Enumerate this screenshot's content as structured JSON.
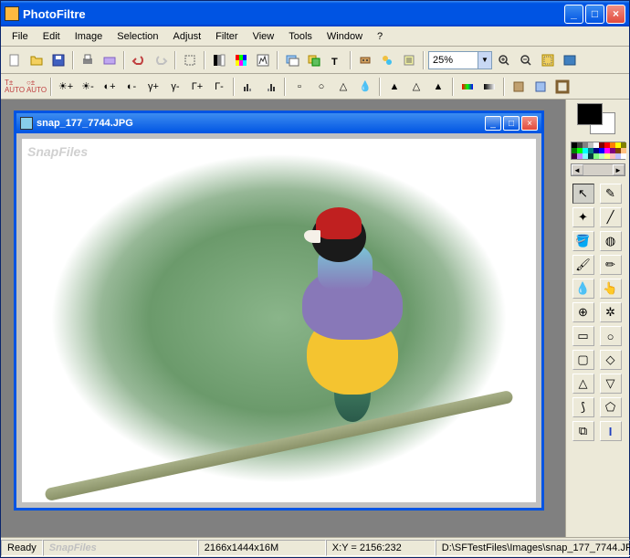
{
  "app": {
    "title": "PhotoFiltre"
  },
  "menu": [
    "File",
    "Edit",
    "Image",
    "Selection",
    "Adjust",
    "Filter",
    "View",
    "Tools",
    "Window",
    "?"
  ],
  "toolbar1_icons": [
    "new-icon",
    "open-icon",
    "save-icon",
    "print-icon",
    "scanner-icon",
    "undo-icon",
    "redo-icon",
    "selection-rect-icon",
    "grayscale-icon",
    "palette-icon",
    "levels-icon",
    "image-manager-icon",
    "layers-icon",
    "text-icon",
    "plugin-icon",
    "effects-icon",
    "options-icon"
  ],
  "zoom": {
    "value": "25%"
  },
  "toolbar1_zoom_icons": [
    "zoom-in-icon",
    "zoom-out-icon",
    "fit-window-icon",
    "fullscreen-icon"
  ],
  "toolbar2_icons": [
    "auto-levels-icon",
    "auto-contrast-icon",
    "bright-plus-icon",
    "bright-minus-icon",
    "contrast-plus-icon",
    "contrast-minus-icon",
    "gamma-plus-icon",
    "gamma-minus-icon",
    "sat-plus-icon",
    "sat-minus-icon",
    "hist-left-icon",
    "hist-right-icon",
    "sharpen-icon",
    "blur-icon",
    "sharpen-more-icon",
    "soften-icon",
    "hue-icon",
    "dust-icon",
    "relief-icon",
    "add-noise-icon",
    "gradient-icon",
    "grayscale2-icon",
    "sepia-icon",
    "photo-mask-icon",
    "frame-icon"
  ],
  "document": {
    "filename": "snap_177_7744.JPG",
    "watermark": "SnapFiles"
  },
  "colors": {
    "fg": "#000000",
    "bg": "#ffffff"
  },
  "palette": [
    "#000000",
    "#404040",
    "#808080",
    "#c0c0c0",
    "#ffffff",
    "#800000",
    "#ff0000",
    "#ff8000",
    "#ffff00",
    "#808000",
    "#008000",
    "#00ff00",
    "#00ffff",
    "#008080",
    "#000080",
    "#0000ff",
    "#ff00ff",
    "#800080",
    "#804000",
    "#ffc080",
    "#400040",
    "#c080ff",
    "#80ffff",
    "#004040",
    "#80ff80",
    "#c0ffc0",
    "#ffff80",
    "#ffc0c0",
    "#c0c0ff",
    "#ffffff"
  ],
  "tools": [
    "pointer-icon",
    "eyedropper-icon",
    "magic-wand-icon",
    "line-icon",
    "fill-icon",
    "spray-icon",
    "brush-icon",
    "adv-brush-icon",
    "blur-tool-icon",
    "smudge-icon",
    "clone-icon",
    "sharp-tool-icon",
    "rect-shape-icon",
    "ellipse-shape-icon",
    "rounded-rect-icon",
    "diamond-icon",
    "triangle-icon",
    "triangle-down-icon",
    "lasso-icon",
    "polygon-icon",
    "nudge-icon",
    "text-tool-icon"
  ],
  "status": {
    "ready": "Ready",
    "watermark": "SnapFiles",
    "dimensions": "2166x1444x16M",
    "coords": "X:Y = 2156:232",
    "path": "D:\\SFTestFiles\\Images\\snap_177_7744.JPG"
  }
}
